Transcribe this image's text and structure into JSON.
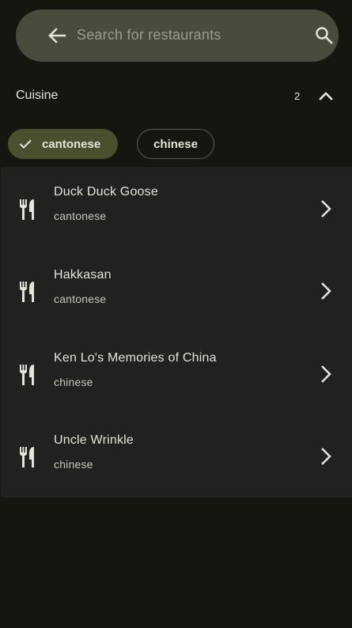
{
  "search": {
    "placeholder": "Search for restaurants"
  },
  "icons": {
    "back": "arrow-left-icon",
    "search": "search-icon",
    "collapse": "chevron-up-icon",
    "check": "check-icon",
    "restaurant": "fork-knife-icon",
    "open": "chevron-right-icon"
  },
  "filter": {
    "title": "Cuisine",
    "count": "2",
    "chips": [
      {
        "label": "cantonese",
        "selected": true
      },
      {
        "label": "chinese",
        "selected": false
      }
    ]
  },
  "results": [
    {
      "name": "Duck Duck Goose",
      "cuisine": "cantonese"
    },
    {
      "name": "Hakkasan",
      "cuisine": "cantonese"
    },
    {
      "name": "Ken Lo's Memories of China",
      "cuisine": "chinese"
    },
    {
      "name": "Uncle Wrinkle",
      "cuisine": "chinese"
    }
  ],
  "colors": {
    "background": "#15160f",
    "search_bar": "#4a4a3d",
    "list_background": "#212120",
    "chip_selected": "#4b4f2e",
    "text": "#e6e3d8"
  }
}
